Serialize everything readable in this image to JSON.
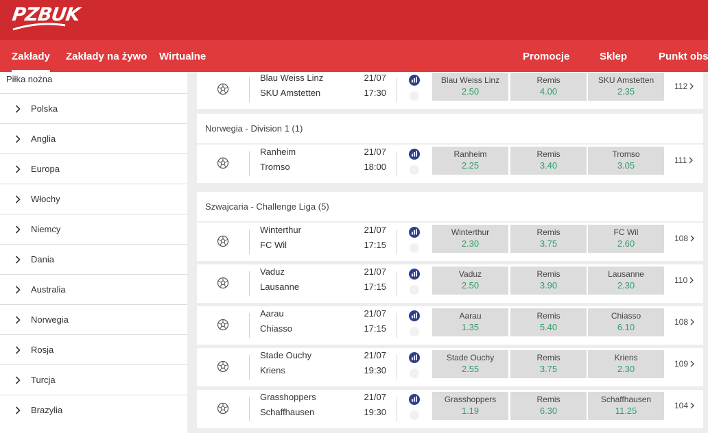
{
  "brand": {
    "logo_text": "PZBUK",
    "primary": "#cf2a2e",
    "nav_bg": "#e03a3c",
    "odds_color": "#2f9e6a",
    "stats_color": "#2e3f8f"
  },
  "nav": {
    "left": [
      "Zakłady",
      "Zakłady na żywo",
      "Wirtualne"
    ],
    "right": [
      "Promocje",
      "Sklep",
      "Punkt obsł"
    ]
  },
  "sidebar": {
    "title": "Piłka nożna",
    "items": [
      "Polska",
      "Anglia",
      "Europa",
      "Włochy",
      "Niemcy",
      "Dania",
      "Australia",
      "Norwegia",
      "Rosja",
      "Turcja",
      "Brazylia"
    ]
  },
  "main": {
    "top_match": {
      "home": "Blau Weiss Linz",
      "away": "SKU Amstetten",
      "date": "21/07",
      "time": "17:30",
      "odds": [
        {
          "name": "Blau Weiss Linz",
          "value": "2.50"
        },
        {
          "name": "Remis",
          "value": "4.00"
        },
        {
          "name": "SKU Amstetten",
          "value": "2.35"
        }
      ],
      "count": "112"
    },
    "leagues": [
      {
        "name": "Norwegia - Division 1 (1)",
        "matches": [
          {
            "home": "Ranheim",
            "away": "Tromso",
            "date": "21/07",
            "time": "18:00",
            "odds": [
              {
                "name": "Ranheim",
                "value": "2.25"
              },
              {
                "name": "Remis",
                "value": "3.40"
              },
              {
                "name": "Tromso",
                "value": "3.05"
              }
            ],
            "count": "111"
          }
        ]
      },
      {
        "name": "Szwajcaria - Challenge Liga (5)",
        "matches": [
          {
            "home": "Winterthur",
            "away": "FC Wil",
            "date": "21/07",
            "time": "17:15",
            "odds": [
              {
                "name": "Winterthur",
                "value": "2.30"
              },
              {
                "name": "Remis",
                "value": "3.75"
              },
              {
                "name": "FC Wil",
                "value": "2.60"
              }
            ],
            "count": "108"
          },
          {
            "home": "Vaduz",
            "away": "Lausanne",
            "date": "21/07",
            "time": "17:15",
            "odds": [
              {
                "name": "Vaduz",
                "value": "2.50"
              },
              {
                "name": "Remis",
                "value": "3.90"
              },
              {
                "name": "Lausanne",
                "value": "2.30"
              }
            ],
            "count": "110"
          },
          {
            "home": "Aarau",
            "away": "Chiasso",
            "date": "21/07",
            "time": "17:15",
            "odds": [
              {
                "name": "Aarau",
                "value": "1.35"
              },
              {
                "name": "Remis",
                "value": "5.40"
              },
              {
                "name": "Chiasso",
                "value": "6.10"
              }
            ],
            "count": "108"
          },
          {
            "home": "Stade Ouchy",
            "away": "Kriens",
            "date": "21/07",
            "time": "19:30",
            "odds": [
              {
                "name": "Stade Ouchy",
                "value": "2.55"
              },
              {
                "name": "Remis",
                "value": "3.75"
              },
              {
                "name": "Kriens",
                "value": "2.30"
              }
            ],
            "count": "109"
          },
          {
            "home": "Grasshoppers",
            "away": "Schaffhausen",
            "date": "21/07",
            "time": "19:30",
            "odds": [
              {
                "name": "Grasshoppers",
                "value": "1.19"
              },
              {
                "name": "Remis",
                "value": "6.30"
              },
              {
                "name": "Schaffhausen",
                "value": "11.25"
              }
            ],
            "count": "104"
          }
        ]
      }
    ]
  }
}
